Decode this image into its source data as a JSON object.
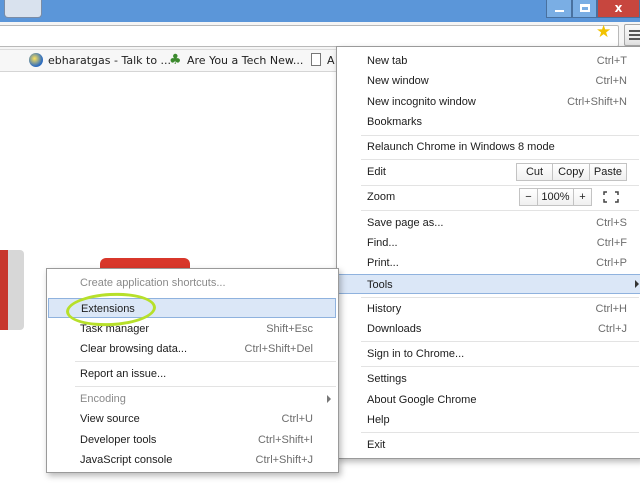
{
  "window": {
    "close_label": "x"
  },
  "toolbar": {
    "star_icon": "star-icon",
    "menu_icon": "hamburger-icon"
  },
  "bookmarks": [
    {
      "label": "ebharatgas - Talk to ...",
      "icon": "globe-icon"
    },
    {
      "label": "Are You a Tech New...",
      "icon": "leaf-icon"
    },
    {
      "label": "A",
      "icon": "page-icon"
    }
  ],
  "main_menu": {
    "new_tab": {
      "label": "New tab",
      "shortcut": "Ctrl+T"
    },
    "new_window": {
      "label": "New window",
      "shortcut": "Ctrl+N"
    },
    "new_incognito": {
      "label": "New incognito window",
      "shortcut": "Ctrl+Shift+N"
    },
    "bookmarks": {
      "label": "Bookmarks"
    },
    "relaunch": {
      "label": "Relaunch Chrome in Windows 8 mode"
    },
    "edit": {
      "label": "Edit",
      "cut": "Cut",
      "copy": "Copy",
      "paste": "Paste"
    },
    "zoom": {
      "label": "Zoom",
      "minus": "−",
      "level": "100%",
      "plus": "+",
      "fullscreen_icon": "fullscreen-icon"
    },
    "save_page": {
      "label": "Save page as...",
      "shortcut": "Ctrl+S"
    },
    "find": {
      "label": "Find...",
      "shortcut": "Ctrl+F"
    },
    "print": {
      "label": "Print...",
      "shortcut": "Ctrl+P"
    },
    "tools": {
      "label": "Tools"
    },
    "history": {
      "label": "History",
      "shortcut": "Ctrl+H"
    },
    "downloads": {
      "label": "Downloads",
      "shortcut": "Ctrl+J"
    },
    "sign_in": {
      "label": "Sign in to Chrome..."
    },
    "settings": {
      "label": "Settings"
    },
    "about": {
      "label": "About Google Chrome"
    },
    "help": {
      "label": "Help"
    },
    "exit": {
      "label": "Exit"
    }
  },
  "tools_menu": {
    "create_shortcuts": {
      "label": "Create application shortcuts..."
    },
    "extensions": {
      "label": "Extensions"
    },
    "task_manager": {
      "label": "Task manager",
      "shortcut": "Shift+Esc"
    },
    "clear_data": {
      "label": "Clear browsing data...",
      "shortcut": "Ctrl+Shift+Del"
    },
    "report_issue": {
      "label": "Report an issue..."
    },
    "encoding": {
      "label": "Encoding"
    },
    "view_source": {
      "label": "View source",
      "shortcut": "Ctrl+U"
    },
    "dev_tools": {
      "label": "Developer tools",
      "shortcut": "Ctrl+Shift+I"
    },
    "js_console": {
      "label": "JavaScript console",
      "shortcut": "Ctrl+Shift+J"
    }
  },
  "colors": {
    "titlebar": "#5b96d9",
    "highlight": "#dbe7f7",
    "annotation": "#b7e02a"
  }
}
